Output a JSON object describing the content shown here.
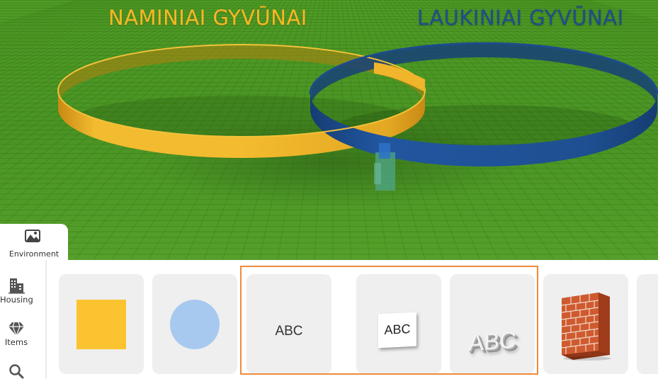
{
  "scene": {
    "title_left": "NAMINIAI GYVŪNAI",
    "title_right": "LAUKINIAI GYVŪNAI",
    "ground_color": "#4e9b25",
    "ring_left_color": "#f0b52b",
    "ring_right_color": "#1f4f8c"
  },
  "environment_tab": {
    "label": "Environment",
    "icon": "landscape-icon"
  },
  "side_nav": [
    {
      "label": "Housing",
      "icon": "buildings-icon"
    },
    {
      "label": "Items",
      "icon": "gem-icon"
    },
    {
      "label": "",
      "icon": "search-icon"
    }
  ],
  "catalog": {
    "cards": [
      {
        "name": "square",
        "icon": "yellow-square",
        "color": "#fcc331"
      },
      {
        "name": "circle",
        "icon": "blue-circle",
        "color": "#a7c9ef"
      },
      {
        "name": "text-plain",
        "text": "ABC"
      },
      {
        "name": "text-sign",
        "text": "ABC"
      },
      {
        "name": "text-3d",
        "text": "ABC"
      },
      {
        "name": "brick-wall",
        "icon": "brick-wall-icon",
        "color": "#c8502a"
      }
    ],
    "selection_color": "#ef8a3b"
  }
}
